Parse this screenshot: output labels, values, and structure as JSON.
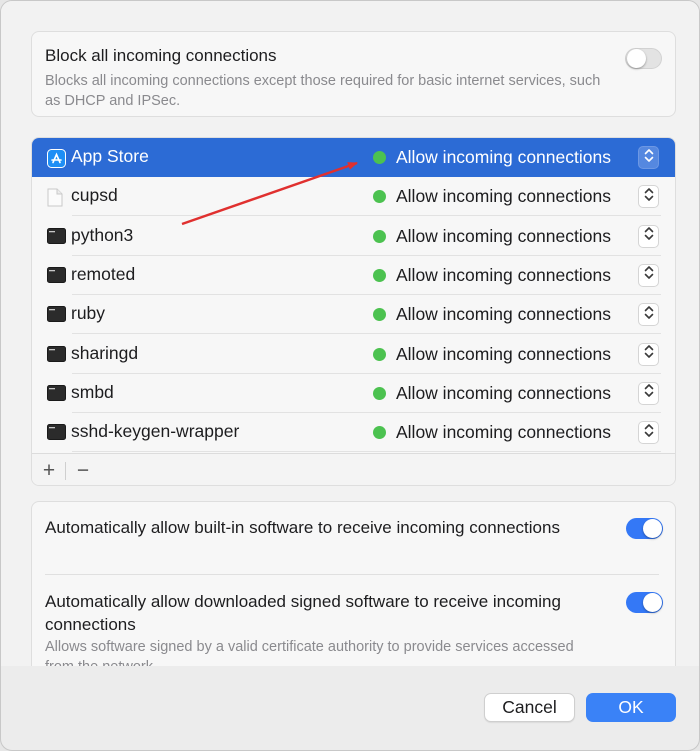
{
  "block_card": {
    "title": "Block all incoming connections",
    "description": "Blocks all incoming connections except those required for basic internet services, such as DHCP and IPSec.",
    "toggle_on": false
  },
  "apps": [
    {
      "name": "App Store",
      "permission": "Allow incoming connections",
      "icon": "app-store-icon",
      "selected": true
    },
    {
      "name": "cupsd",
      "permission": "Allow incoming connections",
      "icon": "document-icon",
      "selected": false
    },
    {
      "name": "python3",
      "permission": "Allow incoming connections",
      "icon": "terminal-icon",
      "selected": false
    },
    {
      "name": "remoted",
      "permission": "Allow incoming connections",
      "icon": "terminal-icon",
      "selected": false
    },
    {
      "name": "ruby",
      "permission": "Allow incoming connections",
      "icon": "terminal-icon",
      "selected": false
    },
    {
      "name": "sharingd",
      "permission": "Allow incoming connections",
      "icon": "terminal-icon",
      "selected": false
    },
    {
      "name": "smbd",
      "permission": "Allow incoming connections",
      "icon": "terminal-icon",
      "selected": false
    },
    {
      "name": "sshd-keygen-wrapper",
      "permission": "Allow incoming connections",
      "icon": "terminal-icon",
      "selected": false
    }
  ],
  "list_footer": {
    "add_label": "+",
    "remove_label": "−"
  },
  "auto_card": {
    "builtin_title": "Automatically allow built-in software to receive incoming connections",
    "builtin_on": true,
    "signed_title": "Automatically allow downloaded signed software to receive incoming connections",
    "signed_desc": "Allows software signed by a valid certificate authority to provide services accessed from the network.",
    "signed_on": true
  },
  "buttons": {
    "cancel": "Cancel",
    "ok": "OK"
  },
  "colors": {
    "accent": "#3478f6",
    "selection": "#2c6bd5",
    "status_green": "#4cc250",
    "annotation_arrow": "#e0302f"
  }
}
